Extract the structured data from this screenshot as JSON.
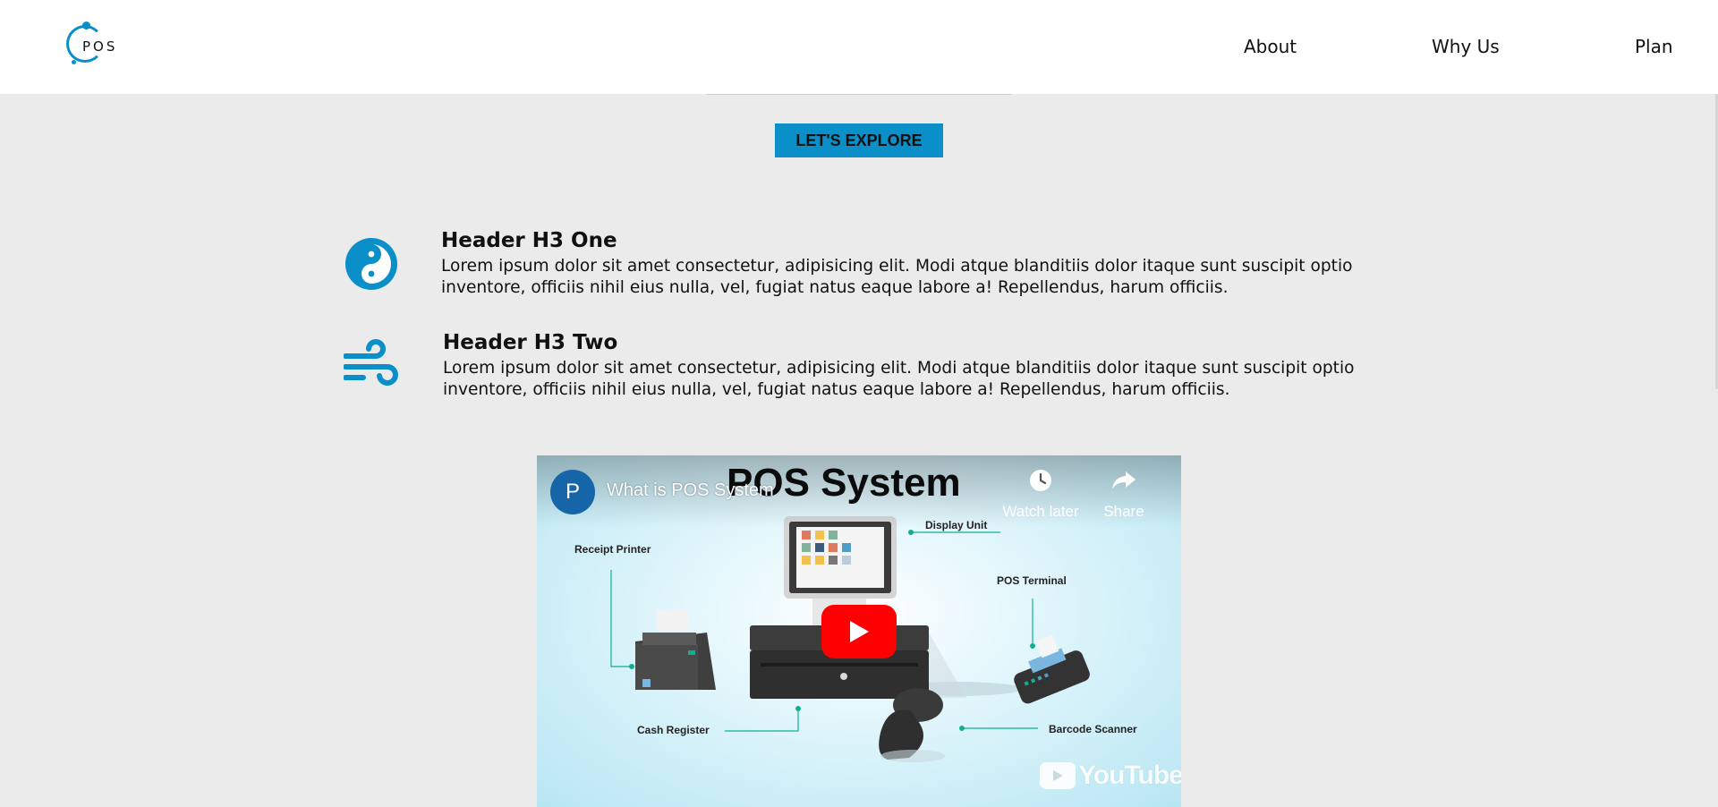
{
  "brand": {
    "logo_text": "POS"
  },
  "nav": {
    "about": "About",
    "why_us": "Why Us",
    "plan": "Plan"
  },
  "hero": {
    "explore_button": "LET'S EXPLORE"
  },
  "features": [
    {
      "icon": "yin-yang-icon",
      "title": "Header H3 One",
      "text": "Lorem ipsum dolor sit amet consectetur, adipisicing elit. Modi atque blanditiis dolor itaque sunt suscipit optio inventore, officiis nihil eius nulla, vel, fugiat natus eaque labore a! Repellendus, harum officiis."
    },
    {
      "icon": "wind-icon",
      "title": "Header H3 Two",
      "text": "Lorem ipsum dolor sit amet consectetur, adipisicing elit. Modi atque blanditiis dolor itaque sunt suscipit optio inventore, officiis nihil eius nulla, vel, fugiat natus eaque labore a! Repellendus, harum officiis."
    }
  ],
  "video": {
    "channel_initial": "P",
    "title": "What is POS System",
    "poster_heading": "POS System",
    "watch_later": "Watch later",
    "share": "Share",
    "youtube_wordmark": "YouTube",
    "labels": {
      "display_unit": "Display Unit",
      "receipt_printer": "Receipt Printer",
      "pos_terminal": "POS Terminal",
      "cash_register": "Cash Register",
      "barcode_scanner": "Barcode Scanner"
    }
  },
  "colors": {
    "accent": "#0a8fc9",
    "page_bg": "#ebebeb",
    "youtube_red": "#ff0000"
  }
}
